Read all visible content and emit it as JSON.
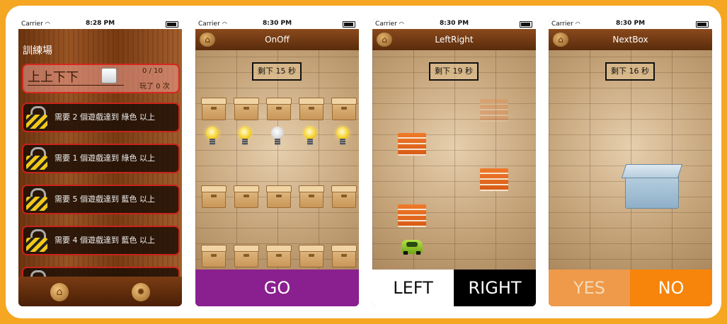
{
  "colors": {
    "border": "#f5a623",
    "go": "#8a1f8f",
    "no": "#f7850b",
    "yes": "#ee9a4a"
  },
  "screens": [
    {
      "status": {
        "carrier": "Carrier",
        "time": "8:28 PM"
      },
      "title": "訓練場",
      "featured": {
        "name": "上上下下",
        "progress": "0 / 10",
        "played": "玩了 0 次"
      },
      "locked": [
        {
          "text": "需要 2 個遊戲達到 綠色 以上"
        },
        {
          "text": "需要 1 個遊戲達到 綠色 以上"
        },
        {
          "text": "需要 5 個遊戲達到 藍色 以上"
        },
        {
          "text": "需要 4 個遊戲達到 藍色 以上"
        }
      ],
      "tabbar": {
        "home_icon": "home-icon",
        "settings_icon": "gear-icon"
      }
    },
    {
      "status": {
        "carrier": "Carrier",
        "time": "8:30 PM"
      },
      "title": "OnOff",
      "timer": "剩下 15 秒",
      "bulbs": [
        "on",
        "on",
        "off",
        "on",
        "on"
      ],
      "action": "GO"
    },
    {
      "status": {
        "carrier": "Carrier",
        "time": "8:30 PM"
      },
      "title": "LeftRight",
      "timer": "剩下 19 秒",
      "left": "LEFT",
      "right": "RIGHT"
    },
    {
      "status": {
        "carrier": "Carrier",
        "time": "8:30 PM"
      },
      "title": "NextBox",
      "timer": "剩下 16 秒",
      "yes": "YES",
      "no": "NO"
    }
  ]
}
